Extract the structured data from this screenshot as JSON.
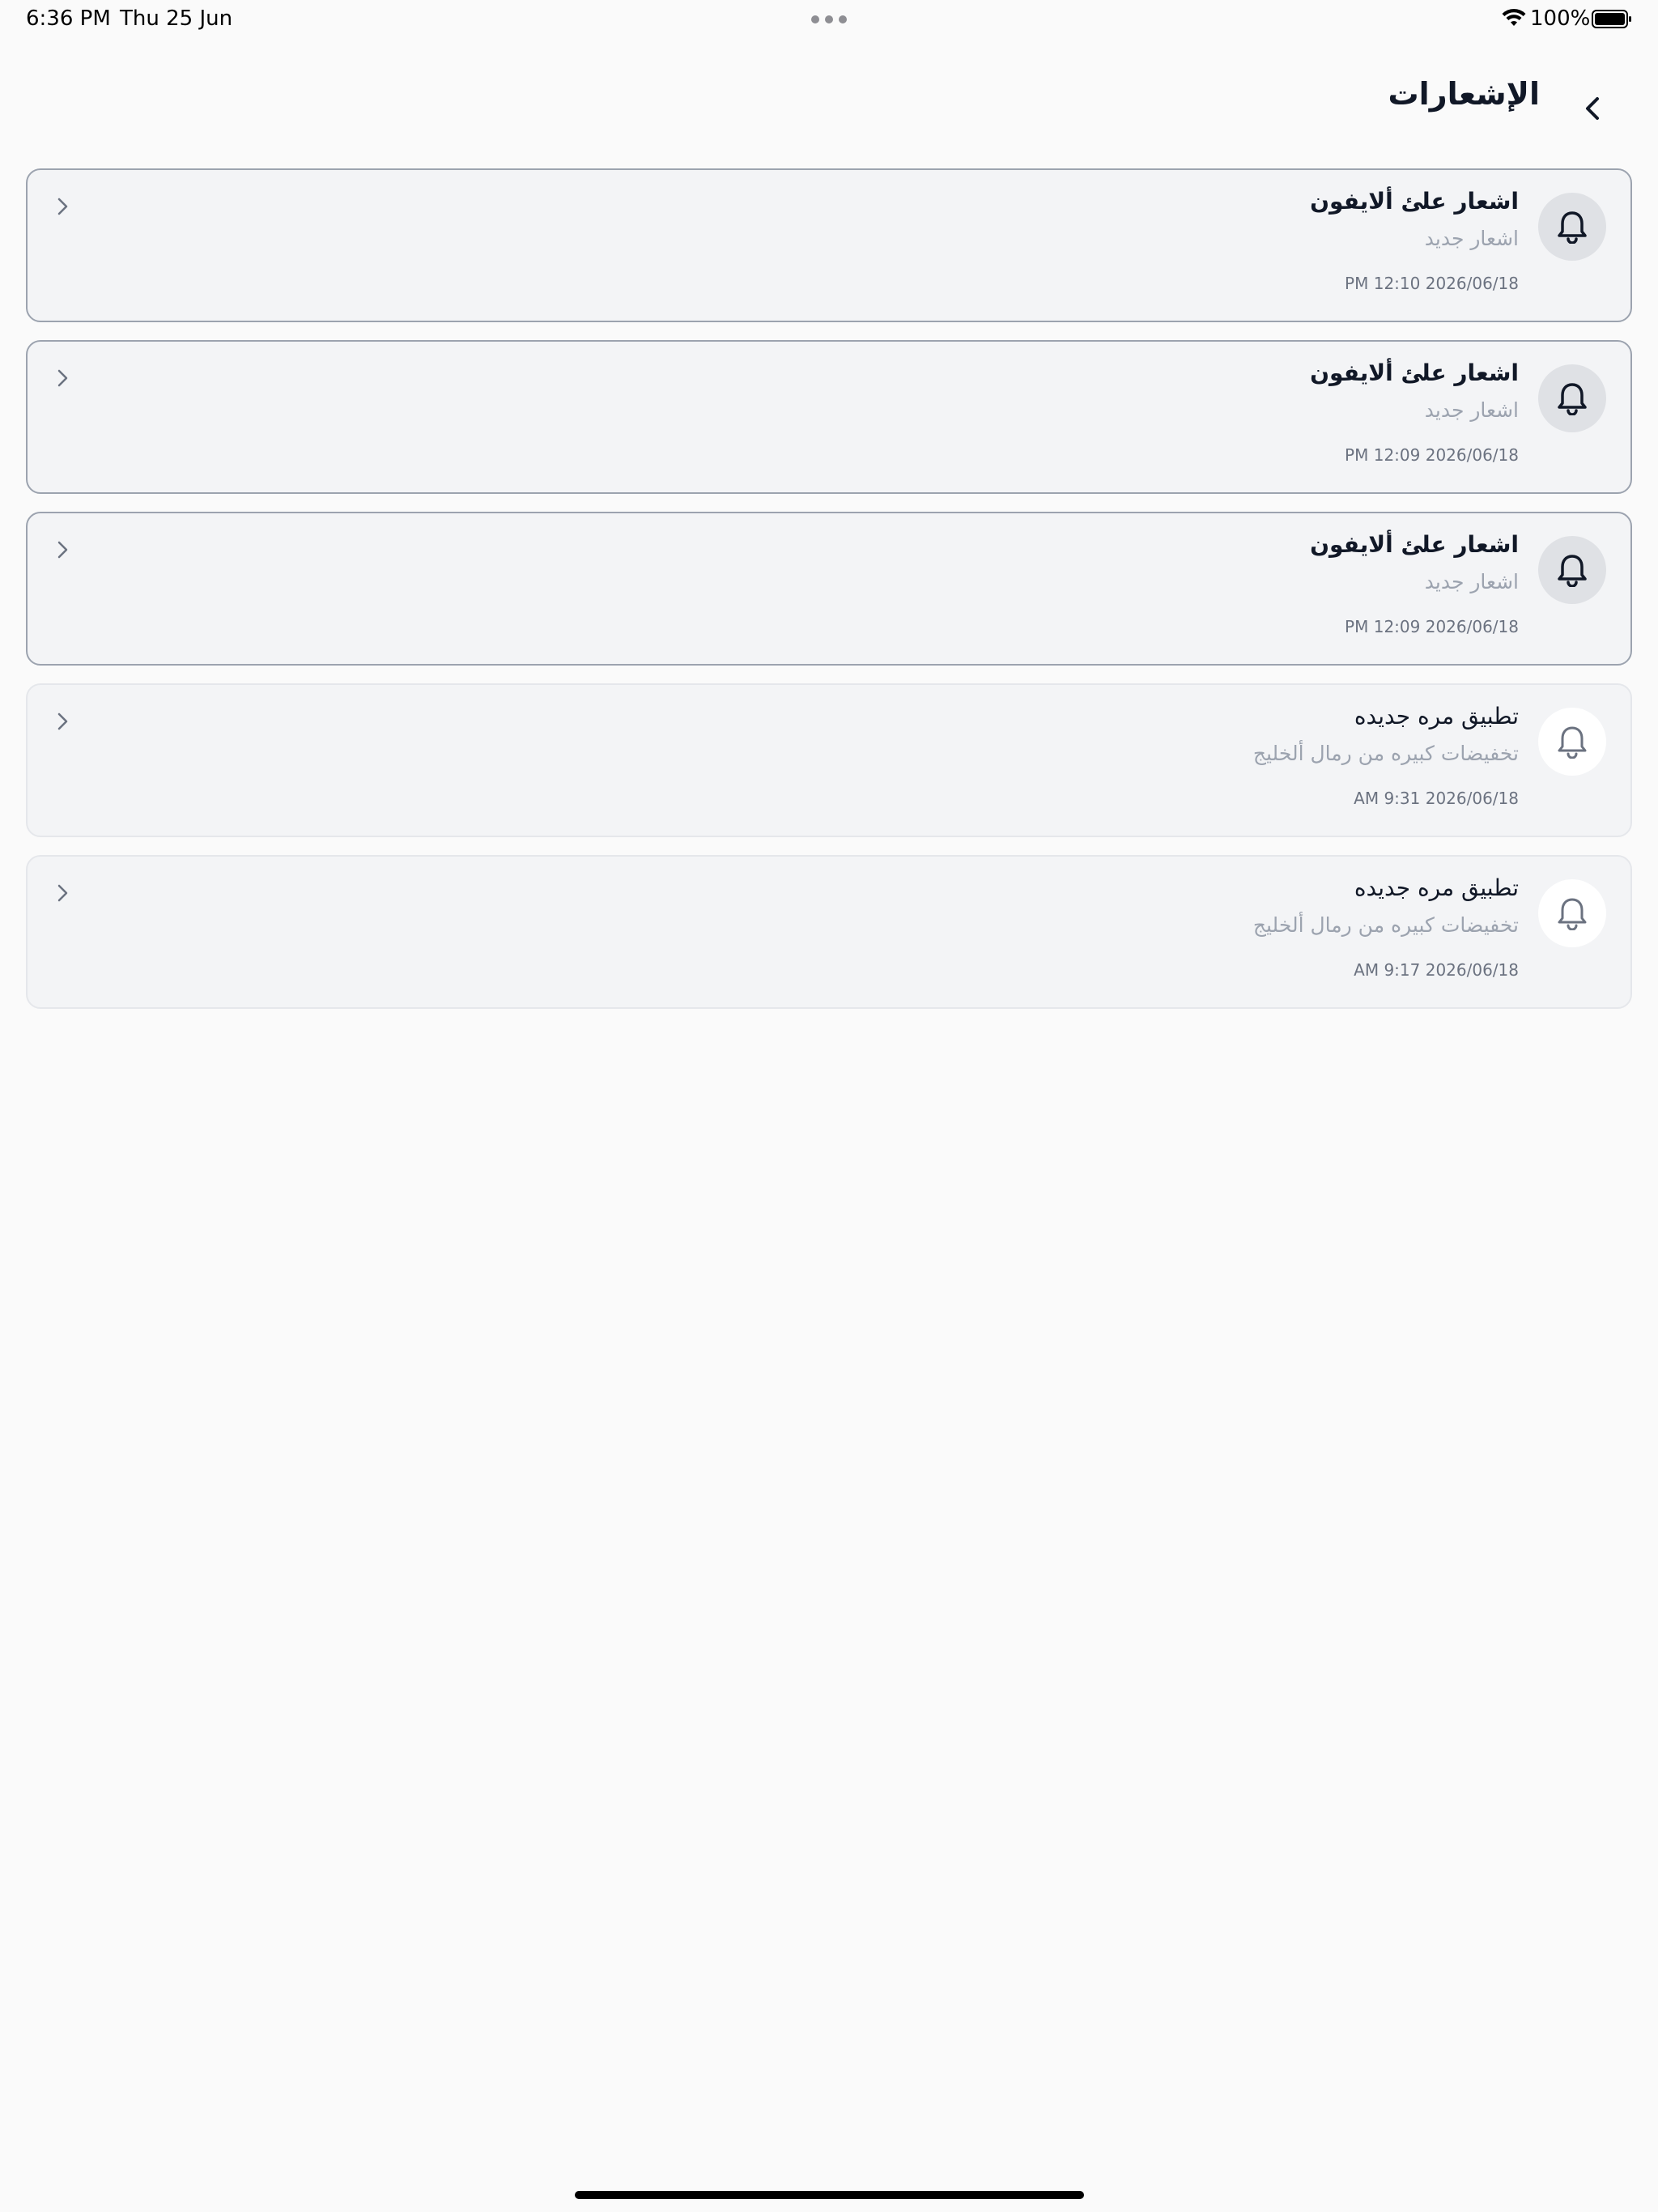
{
  "status_bar": {
    "time": "6:36 PM",
    "date": "Thu 25 Jun",
    "battery": "100%"
  },
  "header": {
    "title": "الإشعارات",
    "back_icon": "chevron-left-icon"
  },
  "notifications": [
    {
      "title": "اشعار علئ ألايفون",
      "subtitle": "اشعار جديد",
      "time": "PM 12:10 2026/06/18",
      "read": false,
      "icon": "bell-icon"
    },
    {
      "title": "اشعار علئ ألايفون",
      "subtitle": "اشعار جديد",
      "time": "PM 12:09 2026/06/18",
      "read": false,
      "icon": "bell-icon"
    },
    {
      "title": "اشعار علئ ألايفون",
      "subtitle": "اشعار جديد",
      "time": "PM 12:09 2026/06/18",
      "read": false,
      "icon": "bell-icon"
    },
    {
      "title": "تطبيق مره جديده",
      "subtitle": "تخفيضات كبيره من رمال ألخليج",
      "time": "AM 9:31 2026/06/18",
      "read": true,
      "icon": "bell-icon"
    },
    {
      "title": "تطبيق مره جديده",
      "subtitle": "تخفيضات كبيره من رمال ألخليج",
      "time": "AM 9:17 2026/06/18",
      "read": true,
      "icon": "bell-icon"
    }
  ],
  "colors": {
    "background": "#fafafa",
    "card_background": "#f3f4f6",
    "unread_border": "#9ca3af",
    "read_border": "#e5e7eb",
    "title_text": "#111827",
    "secondary_text": "#9ca3af"
  }
}
